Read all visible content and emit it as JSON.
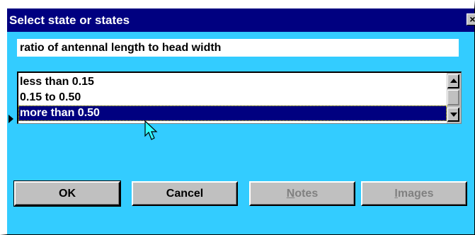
{
  "dialog": {
    "title": "Select state or states",
    "close_glyph": "×"
  },
  "character": {
    "name": "ratio of antennal length to head width"
  },
  "states": {
    "items": [
      {
        "label": "less than 0.15",
        "selected": false
      },
      {
        "label": "0.15 to 0.50",
        "selected": false
      },
      {
        "label": "more than 0.50",
        "selected": true
      }
    ]
  },
  "buttons": {
    "ok": "OK",
    "cancel": "Cancel",
    "notes": "Notes",
    "images": "Images"
  },
  "icons": {
    "close": "close-icon",
    "scroll_up": "arrow-up-icon",
    "scroll_down": "arrow-down-icon",
    "row_marker": "triangle-right-icon",
    "cursor": "mouse-pointer-icon"
  },
  "colors": {
    "background": "#33ccff",
    "titlebar": "#000080",
    "selection": "#000080",
    "button_face": "#c0c0c0",
    "disabled_text": "#808080"
  }
}
